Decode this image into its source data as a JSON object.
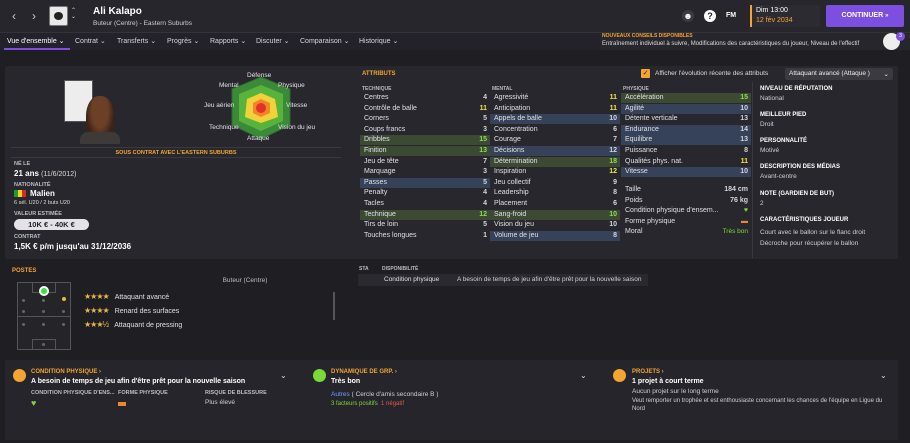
{
  "header": {
    "player_name": "Ali Kalapo",
    "player_sub": "Buteur (Centre) - Eastern Suburbs",
    "date_day": "Dim 13:00",
    "date_full": "12 fév 2034",
    "continue_label": "CONTINUER",
    "fm_label": "FM"
  },
  "tabs": [
    {
      "label": "Vue d'ensemble"
    },
    {
      "label": "Contrat"
    },
    {
      "label": "Transferts"
    },
    {
      "label": "Progrès"
    },
    {
      "label": "Rapports"
    },
    {
      "label": "Discuter"
    },
    {
      "label": "Comparaison"
    },
    {
      "label": "Historique"
    }
  ],
  "advice": {
    "title": "NOUVEAUX CONSEILS DISPONIBLES",
    "text": "Entraînement individuel à suivre, Modifications des caractéristiques du joueur, Niveau de l'effectif",
    "count": "3"
  },
  "profile": {
    "contract_banner": "SOUS CONTRAT AVEC L'EASTERN SUBURBS",
    "born_label": "NÉ LE",
    "age": "21 ans",
    "birth": "(11/6/2012)",
    "nationality_label": "NATIONALITÉ",
    "nationality": "Malien",
    "caps": "6 sél. U20 / 2 buts U20",
    "value_label": "VALEUR ESTIMÉE",
    "value": "10K € - 40K €",
    "contract_label": "CONTRAT",
    "contract": "1,5K € p/m jusqu'au 31/12/2036"
  },
  "radar": {
    "labels": [
      "Défense",
      "Physique",
      "Vitesse",
      "Vision du jeu",
      "Attaque",
      "Technique",
      "Jeu aérien",
      "Mental"
    ]
  },
  "attributes": {
    "title": "ATTRIBUTS",
    "show_evolution": "Afficher l'évolution récente des attributs",
    "role": "Attaquant avancé (Attaque )",
    "technique_label": "TECHNIQUE",
    "mental_label": "MENTAL",
    "physique_label": "PHYSIQUE",
    "technique": [
      [
        "Centres",
        "4",
        ""
      ],
      [
        "Contrôle de balle",
        "11",
        "y"
      ],
      [
        "Corners",
        "5",
        ""
      ],
      [
        "Coups francs",
        "3",
        ""
      ],
      [
        "Dribbles",
        "15",
        "g"
      ],
      [
        "Finition",
        "13",
        "g"
      ],
      [
        "Jeu de tête",
        "7",
        ""
      ],
      [
        "Marquage",
        "3",
        ""
      ],
      [
        "Passes",
        "5",
        "b"
      ],
      [
        "Penalty",
        "4",
        ""
      ],
      [
        "Tacles",
        "4",
        ""
      ],
      [
        "Technique",
        "12",
        "g"
      ],
      [
        "Tirs de loin",
        "5",
        ""
      ],
      [
        "Touches longues",
        "1",
        ""
      ]
    ],
    "mental": [
      [
        "Agressivité",
        "11",
        "y"
      ],
      [
        "Anticipation",
        "11",
        "y"
      ],
      [
        "Appels de balle",
        "10",
        "b"
      ],
      [
        "Concentration",
        "6",
        ""
      ],
      [
        "Courage",
        "7",
        ""
      ],
      [
        "Décisions",
        "12",
        "b"
      ],
      [
        "Détermination",
        "18",
        "g"
      ],
      [
        "Inspiration",
        "12",
        "y"
      ],
      [
        "Jeu collectif",
        "9",
        ""
      ],
      [
        "Leadership",
        "8",
        ""
      ],
      [
        "Placement",
        "6",
        ""
      ],
      [
        "Sang-froid",
        "10",
        "g"
      ],
      [
        "Vision du jeu",
        "10",
        ""
      ],
      [
        "Volume de jeu",
        "8",
        "b"
      ]
    ],
    "physique": [
      [
        "Accélération",
        "15",
        "g"
      ],
      [
        "Agilité",
        "10",
        "b"
      ],
      [
        "Détente verticale",
        "13",
        ""
      ],
      [
        "Endurance",
        "14",
        "b"
      ],
      [
        "Equilibre",
        "13",
        "b"
      ],
      [
        "Puissance",
        "8",
        ""
      ],
      [
        "Qualités phys. nat.",
        "11",
        "y"
      ],
      [
        "Vitesse",
        "10",
        "b"
      ]
    ],
    "stats": [
      [
        "Taille",
        "184 cm"
      ],
      [
        "Poids",
        "76 kg"
      ],
      [
        "Condition physique d'ensem...",
        "♥"
      ],
      [
        "Forme physique",
        "▬"
      ],
      [
        "Moral",
        "Très bon"
      ]
    ]
  },
  "info": [
    {
      "label": "NIVEAU DE RÉPUTATION",
      "value": "National"
    },
    {
      "label": "MEILLEUR PIED",
      "value": "Droit"
    },
    {
      "label": "PERSONNALITÉ",
      "value": "Motivé"
    },
    {
      "label": "DESCRIPTION DES MÉDIAS",
      "value": "Avant-centre"
    },
    {
      "label": "NOTE (GARDIEN DE BUT)",
      "value": "2"
    },
    {
      "label": "CARACTÉRISTIQUES JOUEUR",
      "value": "Court avec le ballon sur le flanc droit",
      "value2": "Décroche pour récupérer le ballon"
    }
  ],
  "positions": {
    "title": "POSTES",
    "main": "Buteur (Centre)",
    "roles": [
      {
        "stars": "★★★★",
        "label": "Attaquant avancé"
      },
      {
        "stars": "★★★★",
        "label": "Renard des surfaces"
      },
      {
        "stars": "★★★½",
        "label": "Attaquant de pressing"
      }
    ]
  },
  "availability": {
    "sta_label": "STA",
    "disp_label": "DISPONIBILITÉ",
    "item": "Condition physique",
    "text": "A besoin de temps de jeu afin d'être prêt pour la nouvelle saison"
  },
  "bottom": {
    "cond": {
      "title": "CONDITION PHYSIQUE",
      "headline": "A besoin de temps de jeu afin d'être prêt pour la nouvelle saison",
      "c1": "CONDITION PHYSIQUE D'ENS...",
      "c2": "FORME PHYSIQUE",
      "c3": "RISQUE DE BLESSURE",
      "c3val": "Plus élevé"
    },
    "group": {
      "title": "DYNAMIQUE DE GRP.",
      "headline": "Très bon",
      "sub": "Autres",
      "sub2": "( Cercle d'amis secondaire B )",
      "pos": "3 facteurs positifs",
      "neg": "1 négatif"
    },
    "proj": {
      "title": "PROJETS",
      "headline": "1 projet à court terme",
      "sub": "Aucun projet sur le long terme",
      "text1": "Veut remporter un trophée et est enthousiaste concernant les chances de l'équipe en Ligue du",
      "text2": "Nord"
    }
  }
}
